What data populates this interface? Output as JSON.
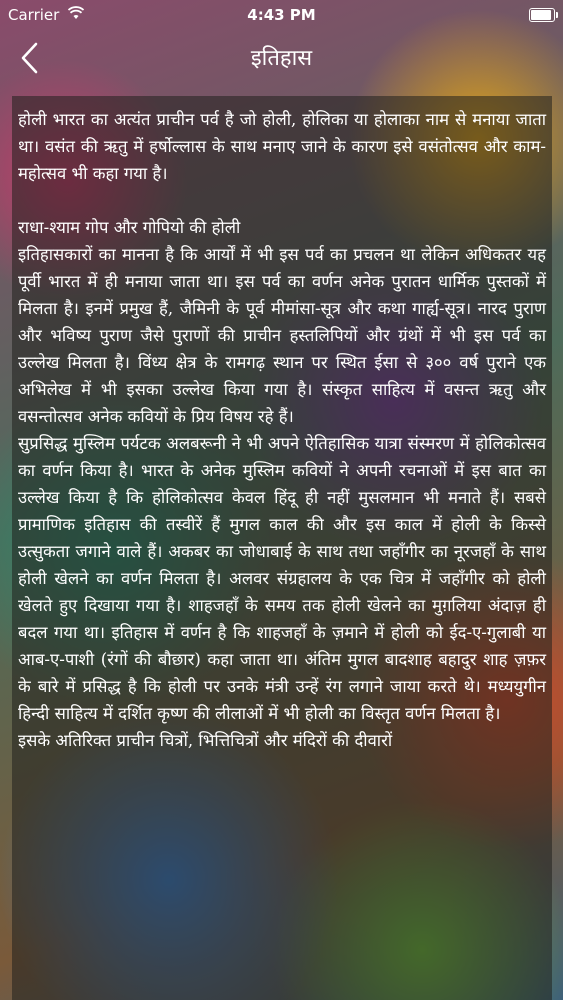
{
  "status_bar": {
    "carrier": "Carrier",
    "time": "4:43 PM",
    "battery_level": 1.0
  },
  "nav": {
    "title": "इतिहास",
    "back_icon": "chevron-left-icon"
  },
  "article": {
    "body": "होली भारत का अत्यंत प्राचीन पर्व है जो होली, होलिका या होलाका नाम से मनाया जाता था। वसंत की ऋतु में हर्षोल्लास के साथ मनाए जाने के कारण इसे वसंतोत्सव और काम-महोत्सव भी कहा गया है।\n\nराधा-श्याम गोप और गोपियो की होली\nइतिहासकारों का मानना है कि आर्यों में भी इस पर्व का प्रचलन था लेकिन अधिकतर यह पूर्वी भारत में ही मनाया जाता था। इस पर्व का वर्णन अनेक पुरातन धार्मिक पुस्तकों में मिलता है। इनमें प्रमुख हैं, जैमिनी के पूर्व मीमांसा-सूत्र और कथा गार्ह्य-सूत्र। नारद पुराण और भविष्य पुराण जैसे पुराणों की प्राचीन हस्तलिपियों और ग्रंथों में भी इस पर्व का उल्लेख मिलता है। विंध्य क्षेत्र के रामगढ़ स्थान पर स्थित ईसा से ३०० वर्ष पुराने एक अभिलेख में भी इसका उल्लेख किया गया है। संस्कृत साहित्य में वसन्त ऋतु और वसन्तोत्सव अनेक कवियों के प्रिय विषय रहे हैं।\nसुप्रसिद्ध मुस्लिम पर्यटक अलबरूनी ने भी अपने ऐतिहासिक यात्रा संस्मरण में होलिकोत्सव का वर्णन किया है। भारत के अनेक मुस्लिम कवियों ने अपनी रचनाओं में इस बात का उल्लेख किया है कि होलिकोत्सव केवल हिंदू ही नहीं मुसलमान भी मनाते हैं। सबसे प्रामाणिक इतिहास की तस्वीरें हैं मुगल काल की और इस काल में होली के किस्से उत्सुकता जगाने वाले हैं। अकबर का जोधाबाई के साथ तथा जहाँगीर का नूरजहाँ के साथ होली खेलने का वर्णन मिलता है। अलवर संग्रहालय के एक चित्र में जहाँगीर को होली खेलते हुए दिखाया गया है। शाहजहाँ के समय तक होली खेलने का मुग़लिया अंदाज़ ही बदल गया था। इतिहास में वर्णन है कि शाहजहाँ के ज़माने में होली को ईद-ए-गुलाबी या आब-ए-पाशी (रंगों की बौछार) कहा जाता था। अंतिम मुगल बादशाह बहादुर शाह ज़फ़र के बारे में प्रसिद्ध है कि होली पर उनके मंत्री उन्हें रंग लगाने जाया करते थे। मध्ययुगीन हिन्दी साहित्य में दर्शित कृष्ण की लीलाओं में भी होली का विस्तृत वर्णन मिलता है।\nइसके अतिरिक्त प्राचीन चित्रों, भित्तिचित्रों और मंदिरों की दीवारों"
  }
}
